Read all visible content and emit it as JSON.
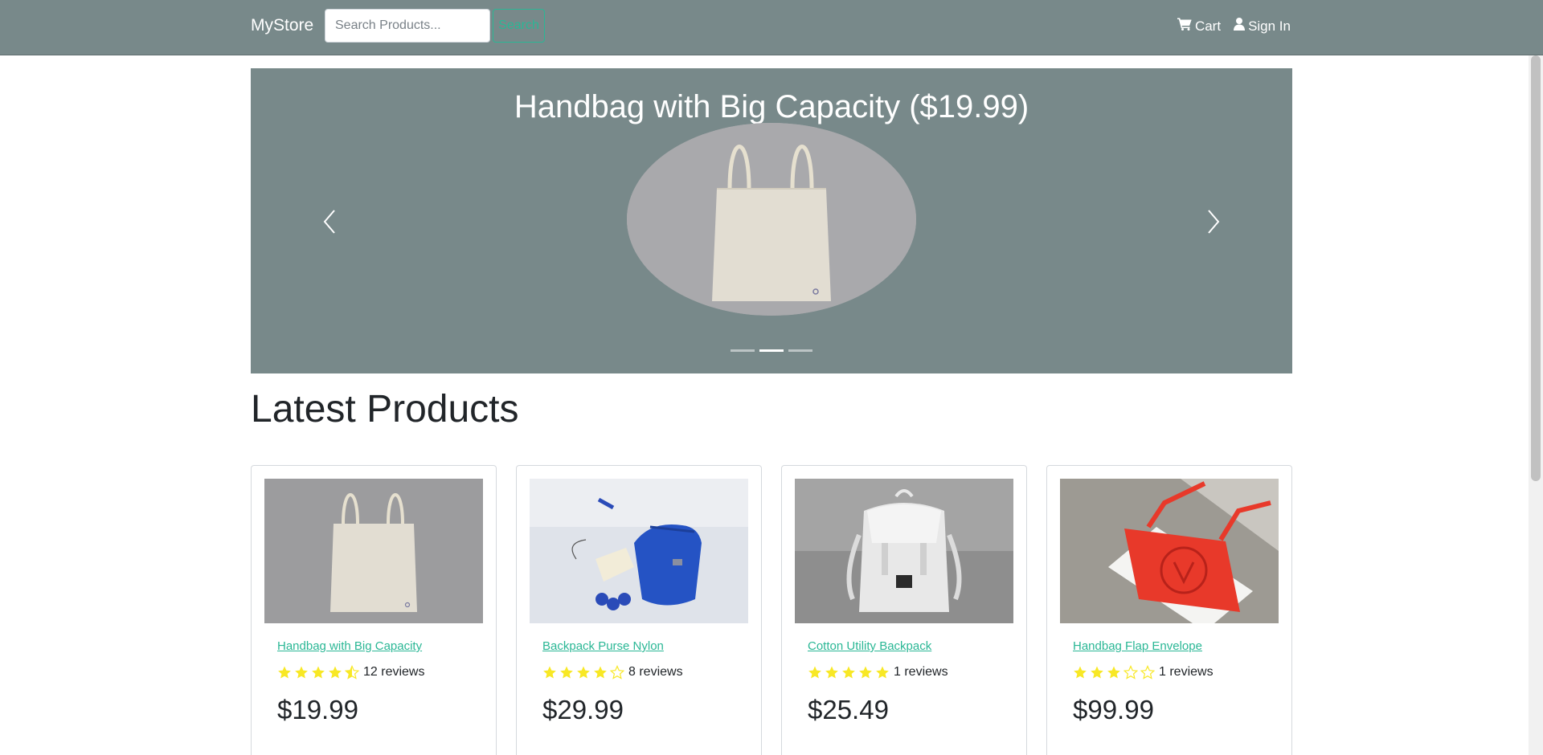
{
  "nav": {
    "brand": "MyStore",
    "search_placeholder": "Search Products...",
    "search_label": "Search",
    "cart_label": "Cart",
    "cart_icon": "shopping-cart-icon",
    "signin_label": "Sign In",
    "signin_icon": "user-icon"
  },
  "carousel": {
    "caption": "Handbag with Big Capacity ($19.99)",
    "slide_count": 3,
    "active_slide": 2,
    "prev_icon": "chevron-left-icon",
    "next_icon": "chevron-right-icon"
  },
  "main": {
    "heading": "Latest Products"
  },
  "products": [
    {
      "name": "Handbag with Big Capacity",
      "rating": 4.5,
      "reviews": "12 reviews",
      "price": "$19.99",
      "image": "canvas tote bag on grey background"
    },
    {
      "name": "Backpack Purse Nylon",
      "rating": 4,
      "reviews": "8 reviews",
      "price": "$29.99",
      "image": "blue backpack with accessories"
    },
    {
      "name": "Cotton Utility Backpack",
      "rating": 5,
      "reviews": "1 reviews",
      "price": "$25.49",
      "image": "white utility backpack"
    },
    {
      "name": "Handbag Flap Envelope",
      "rating": 3,
      "reviews": "1 reviews",
      "price": "$99.99",
      "image": "red envelope handbag"
    }
  ],
  "colors": {
    "navbar": "#78898a",
    "accent": "#2ab795",
    "star": "#f8e825"
  }
}
